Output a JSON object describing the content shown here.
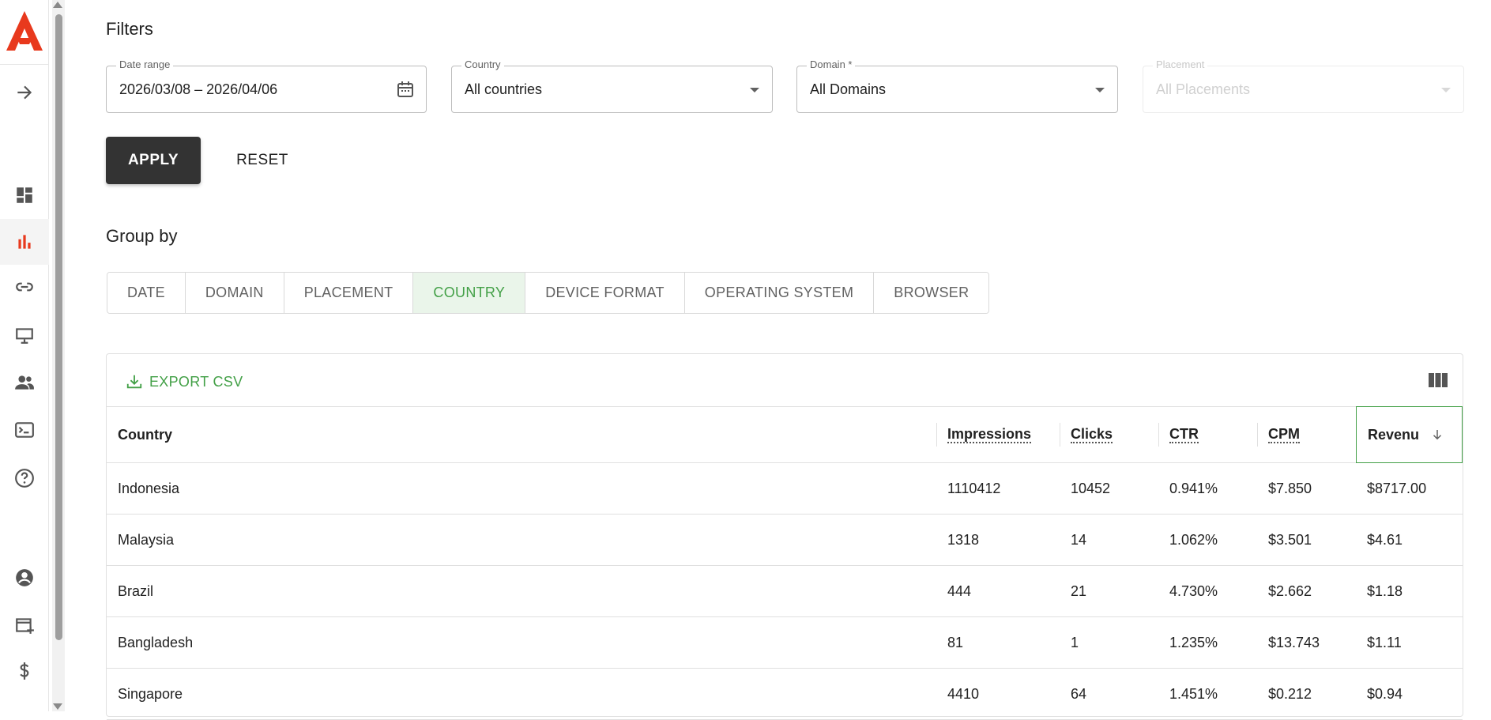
{
  "filters": {
    "title": "Filters",
    "date_range": {
      "label": "Date range",
      "value": "2026/03/08 – 2026/04/06"
    },
    "country": {
      "label": "Country",
      "value": "All countries"
    },
    "domain": {
      "label": "Domain *",
      "value": "All Domains"
    },
    "placement": {
      "label": "Placement",
      "value": "All Placements"
    },
    "apply_label": "APPLY",
    "reset_label": "RESET"
  },
  "group_by": {
    "title": "Group by",
    "tabs": [
      {
        "label": "DATE"
      },
      {
        "label": "DOMAIN"
      },
      {
        "label": "PLACEMENT"
      },
      {
        "label": "COUNTRY",
        "active": true
      },
      {
        "label": "DEVICE FORMAT"
      },
      {
        "label": "OPERATING SYSTEM"
      },
      {
        "label": "BROWSER"
      }
    ]
  },
  "table": {
    "export_label": "EXPORT CSV",
    "columns": [
      "Country",
      "Impressions",
      "Clicks",
      "CTR",
      "CPM",
      "Revenu"
    ],
    "rows": [
      [
        "Indonesia",
        "1110412",
        "10452",
        "0.941%",
        "$7.850",
        "$8717.00"
      ],
      [
        "Malaysia",
        "1318",
        "14",
        "1.062%",
        "$3.501",
        "$4.61"
      ],
      [
        "Brazil",
        "444",
        "21",
        "4.730%",
        "$2.662",
        "$1.18"
      ],
      [
        "Bangladesh",
        "81",
        "1",
        "1.235%",
        "$13.743",
        "$1.11"
      ],
      [
        "Singapore",
        "4410",
        "64",
        "1.451%",
        "$0.212",
        "$0.94"
      ]
    ]
  },
  "colors": {
    "accent": "#43a047",
    "brand": "#e8391d",
    "dark_button": "#333333"
  }
}
